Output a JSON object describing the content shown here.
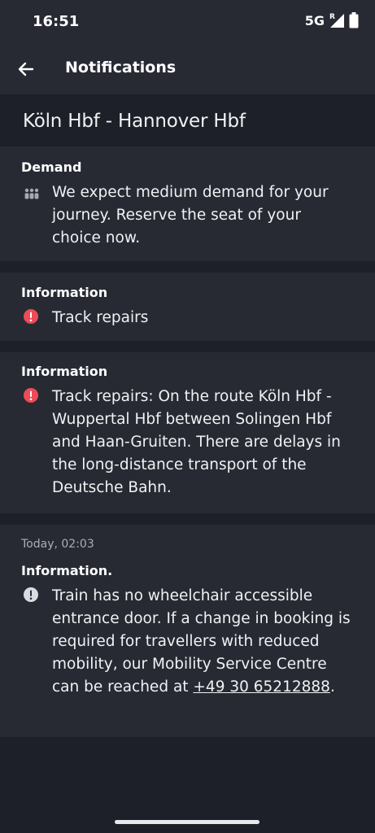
{
  "status_bar": {
    "time": "16:51",
    "network": "5G",
    "roaming": "R"
  },
  "app_bar": {
    "title": "Notifications"
  },
  "route": {
    "title": "Köln Hbf - Hannover Hbf"
  },
  "cards": [
    {
      "title": "Demand",
      "icon": "people-icon",
      "message": "We expect medium demand for your journey. Reserve the seat of your choice now."
    },
    {
      "title": "Information",
      "icon": "alert-icon",
      "message": "Track repairs"
    },
    {
      "title": "Information",
      "icon": "alert-icon",
      "message": "Track repairs: On the route Köln Hbf - Wuppertal Hbf between Solingen Hbf and Haan-Gruiten. There are delays in the long-distance transport of the Deutsche Bahn."
    },
    {
      "timestamp": "Today, 02:03",
      "title": "Information.",
      "icon": "info-icon",
      "message": "Train has no wheelchair accessible entrance door. If a change in booking is required for travellers with reduced mobility, our Mobility Service Centre can be reached at ",
      "phone": "+49 30 65212888",
      "message_end": "."
    }
  ],
  "colors": {
    "background": "#1d2028",
    "card": "#272a33",
    "alert": "#ec4b57",
    "info": "#d9dbe0",
    "demand_icon": "#a5a9b3"
  }
}
